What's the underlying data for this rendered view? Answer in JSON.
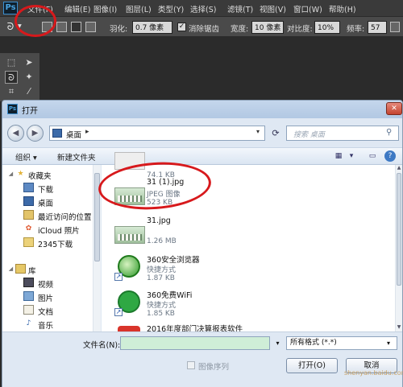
{
  "photoshop": {
    "logo": "Ps",
    "menus": [
      "文件(F)",
      "编辑(E)",
      "图像(I)",
      "图层(L)",
      "类型(Y)",
      "选择(S)",
      "滤镜(T)",
      "视图(V)",
      "窗口(W)",
      "帮助(H)"
    ],
    "options": {
      "feather_label": "羽化:",
      "feather_value": "0.7 像素",
      "antialias_label": "消除锯齿",
      "width_label": "宽度:",
      "width_value": "10 像素",
      "contrast_label": "对比度:",
      "contrast_value": "10%",
      "frequency_label": "频率:",
      "frequency_value": "57"
    }
  },
  "dialog": {
    "title": "打开",
    "address": "桌面",
    "search_placeholder": "搜索 桌面",
    "toolbar": {
      "organize": "组织 ▾",
      "new_folder": "新建文件夹"
    },
    "nav_items": [
      {
        "label": "收藏夹",
        "icon": "star-icon"
      },
      {
        "label": "下载",
        "icon": "download-folder-icon"
      },
      {
        "label": "桌面",
        "icon": "desktop-icon"
      },
      {
        "label": "最近访问的位置",
        "icon": "recent-places-icon"
      },
      {
        "label": "iCloud 照片",
        "icon": "icloud-icon"
      },
      {
        "label": "2345下载",
        "icon": "folder-icon"
      },
      {
        "label": "库",
        "icon": "library-icon"
      },
      {
        "label": "视频",
        "icon": "video-icon"
      },
      {
        "label": "图片",
        "icon": "pictures-icon"
      },
      {
        "label": "文档",
        "icon": "documents-icon"
      },
      {
        "label": "音乐",
        "icon": "music-icon"
      }
    ],
    "files": [
      {
        "name": "",
        "type": "",
        "size": "74.1 KB"
      },
      {
        "name": "31 (1).jpg",
        "type": "JPEG 图像",
        "size": "523 KB"
      },
      {
        "name": "31.jpg",
        "type": "",
        "size": "1.26 MB"
      },
      {
        "name": "360安全浏览器",
        "type": "快捷方式",
        "size": "1.87 KB"
      },
      {
        "name": "360免费WiFi",
        "type": "快捷方式",
        "size": "1.85 KB"
      },
      {
        "name": "2016年度部门决算报表软件",
        "type": "",
        "size": ""
      }
    ],
    "filename_label": "文件名(N):",
    "filename_value": "",
    "format_value": "所有格式 (*.*)",
    "image_sequence_label": "图像序列",
    "open_button": "打开(O)",
    "cancel_button": "取消",
    "watermark": "shenyan.baidu.com"
  },
  "colors": {
    "annotation": "#d7191c",
    "dialog_bg": "#dfe8f3",
    "filename_field": "#cfeed7"
  }
}
